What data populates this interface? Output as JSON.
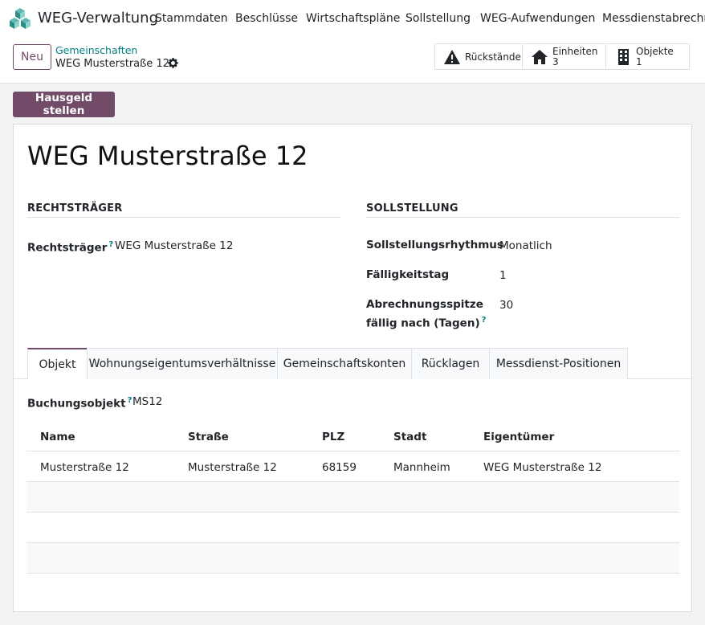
{
  "app": {
    "name": "WEG-Verwaltung"
  },
  "menu": [
    "Stammdaten",
    "Beschlüsse",
    "Wirtschaftspläne",
    "Sollstellung",
    "WEG-Aufwendungen",
    "Messdienstabrechnu"
  ],
  "control": {
    "new_label": "Neu",
    "breadcrumb_parent": "Gemeinschaften",
    "breadcrumb_current": "WEG Musterstraße 12"
  },
  "stats": {
    "rueckstaende": {
      "label": "Rückstände"
    },
    "einheiten": {
      "label": "Einheiten",
      "value": "3"
    },
    "objekte": {
      "label": "Objekte",
      "value": "1"
    }
  },
  "actions": {
    "hausgeld": "Hausgeld stellen"
  },
  "record": {
    "title": "WEG Musterstraße 12"
  },
  "rechtstraeger": {
    "section": "RECHTSTRÄGER",
    "label": "Rechtsträger",
    "help": "?",
    "value": "WEG Musterstraße 12"
  },
  "sollstellung": {
    "section": "SOLLSTELLUNG",
    "rhythm_label": "Sollstellungsrhythmus",
    "rhythm_value": "Monatlich",
    "due_label": "Fälligkeitstag",
    "due_value": "1",
    "peak_label_1": "Abrechnungsspitze",
    "peak_label_2": "fällig nach (Tagen)",
    "peak_help": "?",
    "peak_value": "30"
  },
  "tabs": [
    "Objekt",
    "Wohnungseigentumsverhältnisse",
    "Gemeinschaftskonten",
    "Rücklagen",
    "Messdienst-Positionen"
  ],
  "objekt": {
    "buchung_label": "Buchungsobjekt",
    "buchung_help": "?",
    "buchung_value": "MS12",
    "columns": [
      "Name",
      "Straße",
      "PLZ",
      "Stadt",
      "Eigentümer"
    ],
    "rows": [
      [
        "Musterstraße 12",
        "Musterstraße 12",
        "68159",
        "Mannheim",
        "WEG Musterstraße 12"
      ]
    ]
  },
  "colors": {
    "brand": "#714b67",
    "accent": "#017e84"
  },
  "icons": {
    "logo": "app-logo-icon",
    "gear": "gear-icon",
    "warning": "warning-icon",
    "home": "home-icon",
    "building": "building-icon"
  }
}
